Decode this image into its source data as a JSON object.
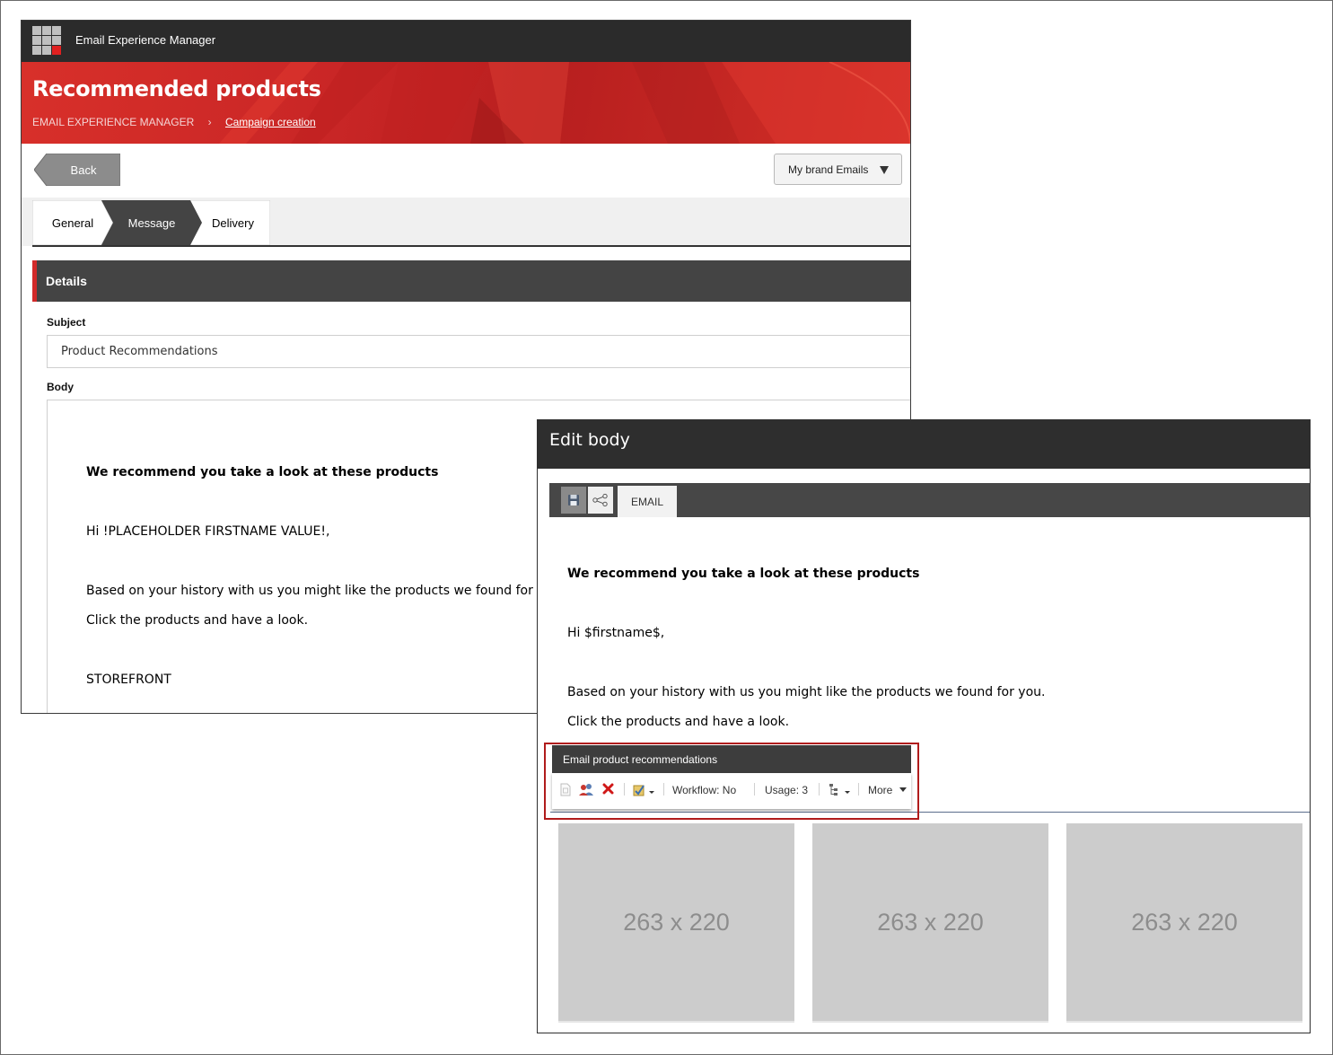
{
  "app": {
    "title": "Email Experience Manager"
  },
  "header": {
    "page_title": "Recommended products",
    "breadcrumb_root": "EMAIL EXPERIENCE MANAGER",
    "breadcrumb_separator": "›",
    "breadcrumb_link": "Campaign creation"
  },
  "actions": {
    "back_label": "Back",
    "brand_dropdown": "My brand Emails"
  },
  "tabs": [
    {
      "label": "General",
      "active": false
    },
    {
      "label": "Message",
      "active": true
    },
    {
      "label": "Delivery",
      "active": false
    }
  ],
  "details": {
    "section_title": "Details",
    "subject_label": "Subject",
    "subject_value": "Product Recommendations",
    "body_label": "Body",
    "body_lines": [
      "We recommend you take a look at these products",
      "Hi !PLACEHOLDER FIRSTNAME VALUE!,",
      "Based on your history with us you might like the products we found for you.",
      "Click the products and have a look.",
      "STOREFRONT"
    ]
  },
  "edit_body": {
    "title": "Edit body",
    "tab_label": "EMAIL",
    "toolbar_icons": [
      "save-icon",
      "share-icon"
    ],
    "lines": [
      "We recommend you take a look at these products",
      "Hi $firstname$,",
      "Based on your history with us you might like the products we found for you.",
      "Click the products and have a look."
    ],
    "rendering": {
      "title": "Email product recommendations",
      "workflow": "Workflow: No",
      "usage": "Usage: 3",
      "more": "More",
      "icons": [
        "page-icon",
        "users-icon",
        "delete-icon",
        "edit-icon",
        "tree-icon"
      ]
    },
    "placeholders": [
      "263 x 220",
      "263 x 220",
      "263 x 220"
    ]
  },
  "colors": {
    "accent_red": "#d22a2a",
    "dark_bar": "#2b2b2b",
    "placeholder_gray": "#cccccc",
    "highlight_border": "#b01b1b"
  }
}
